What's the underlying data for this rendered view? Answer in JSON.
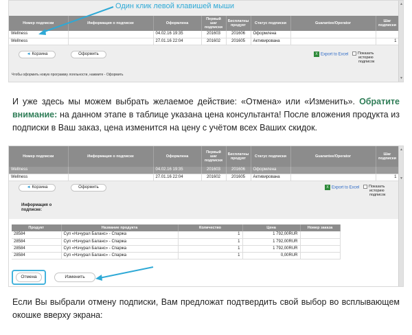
{
  "annotation": {
    "text": "Один клик левой клавишей мыши"
  },
  "subscriptions_table": {
    "columns": [
      "Номер подписки",
      "Информация о подписке",
      "Оформлена",
      "Первый шаг подписки",
      "Бесплатны продукт",
      "Статус подписки",
      "Guarantee/Operator",
      "Шаг подписки"
    ],
    "rows": [
      {
        "number": "Wellness",
        "info": "",
        "date": "04.02.16 19:35",
        "first_step": "201603",
        "free_product": "201606",
        "status": "Оформлена",
        "guarantee": "",
        "step": ""
      },
      {
        "number": "Wellness",
        "info": "",
        "date": "27.01.16 22:04",
        "first_step": "201602",
        "free_product": "201605",
        "status": "Активирована",
        "guarantee": "",
        "step": "1"
      }
    ]
  },
  "buttons": {
    "cart": "Корзина",
    "checkout": "Оформить",
    "cancel": "Отмена",
    "change": "Изменить"
  },
  "export": {
    "label": "Export to Excel"
  },
  "history_toggle": {
    "line1": "Показать",
    "line2": "историю",
    "line3": "подписок"
  },
  "footnote": "Чтобы оформить новую программу лояльности, нажмите - Оформить",
  "paragraph1": {
    "part1": "И уже здесь мы можем выбрать желаемое действие: «Отмена» или «Изменить». ",
    "highlight": "Обратите внимание:",
    "part2": " на данном этапе в таблице указана цена консультанта! После вложения продукта из подписки в Ваш заказ, цена изменится на цену с учётом всех Ваших скидок."
  },
  "subscription_info": {
    "line1": "Информация о",
    "line2": "подписке:"
  },
  "products_table": {
    "columns": [
      "Продукт",
      "Название продукта",
      "Количество",
      "Цена",
      "Номер заказа"
    ],
    "rows": [
      {
        "code": "28584",
        "name": "Суп «Нэчурал Баланс» - Спаржа",
        "qty": "1",
        "price": "1 792,00RUR",
        "order": ""
      },
      {
        "code": "28584",
        "name": "Суп «Нэчурал Баланс» - Спаржа",
        "qty": "1",
        "price": "1 792,00RUR",
        "order": ""
      },
      {
        "code": "28584",
        "name": "Суп «Нэчурал Баланс» - Спаржа",
        "qty": "1",
        "price": "1 792,00RUR",
        "order": ""
      },
      {
        "code": "28584",
        "name": "Суп «Нэчурал Баланс» - Спаржа",
        "qty": "1",
        "price": "0,00RUR",
        "order": ""
      }
    ]
  },
  "paragraph2": "Если Вы выбрали отмену подписки, Вам предложат подтвердить свой выбор во всплывающем окошке вверху экрана:",
  "colors": {
    "accent": "#2ea9d6",
    "highlight_text": "#2f7d57",
    "header_gray": "#8c8c8c"
  }
}
